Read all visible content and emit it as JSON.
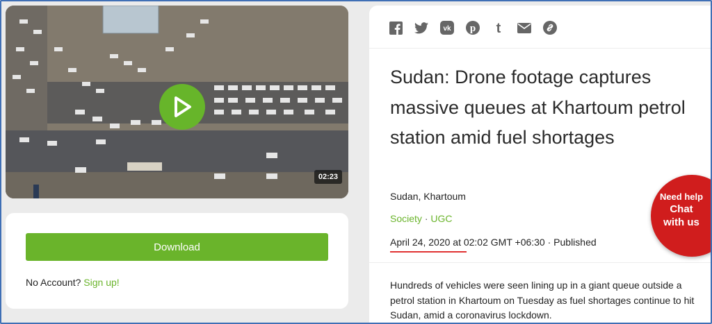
{
  "video": {
    "duration": "02:23",
    "play_icon": "play-icon"
  },
  "download": {
    "button_label": "Download",
    "no_account_text": "No Account?",
    "signup_link": "Sign up!"
  },
  "share_icons": [
    "facebook-icon",
    "twitter-icon",
    "vk-icon",
    "pinterest-icon",
    "tumblr-icon",
    "email-icon",
    "link-icon"
  ],
  "article": {
    "title": "Sudan: Drone footage captures massive queues at Khartoum petrol station amid fuel shortages",
    "location": "Sudan, Khartoum",
    "category_1": "Society",
    "category_separator": "·",
    "category_2": "UGC",
    "date": "April 24, 2020 at 02:02 GMT +06:30 · Published",
    "body": "Hundreds of vehicles were seen lining up in a giant queue outside a petrol station in Khartoum on Tuesday as fuel shortages continue to hit Sudan, amid a coronavirus lockdown."
  },
  "chat_widget": {
    "line1": "Need help",
    "line2": "Chat",
    "line3": "with us"
  },
  "colors": {
    "accent_green": "#6ab42b",
    "play_green": "#67b52a",
    "chat_red": "#d01d1d",
    "date_underline": "#e03131"
  }
}
